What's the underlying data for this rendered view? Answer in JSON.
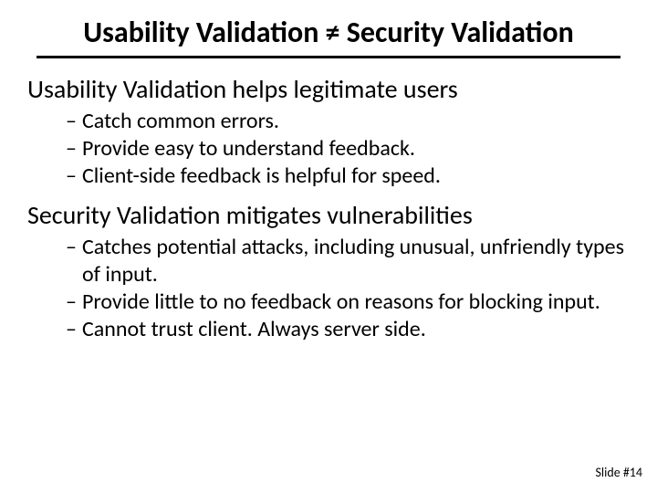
{
  "title": "Usability Validation ≠ Security Validation",
  "section1": {
    "heading": "Usability Validation helps legitimate users",
    "items": [
      "Catch common errors.",
      "Provide easy to understand feedback.",
      "Client-side feedback is helpful for speed."
    ]
  },
  "section2": {
    "heading": "Security Validation mitigates vulnerabilities",
    "items": [
      "Catches potential attacks, including unusual, unfriendly types of input.",
      "Provide little to no feedback on reasons for blocking input.",
      "Cannot trust client.  Always server side."
    ]
  },
  "footer": "Slide #14"
}
